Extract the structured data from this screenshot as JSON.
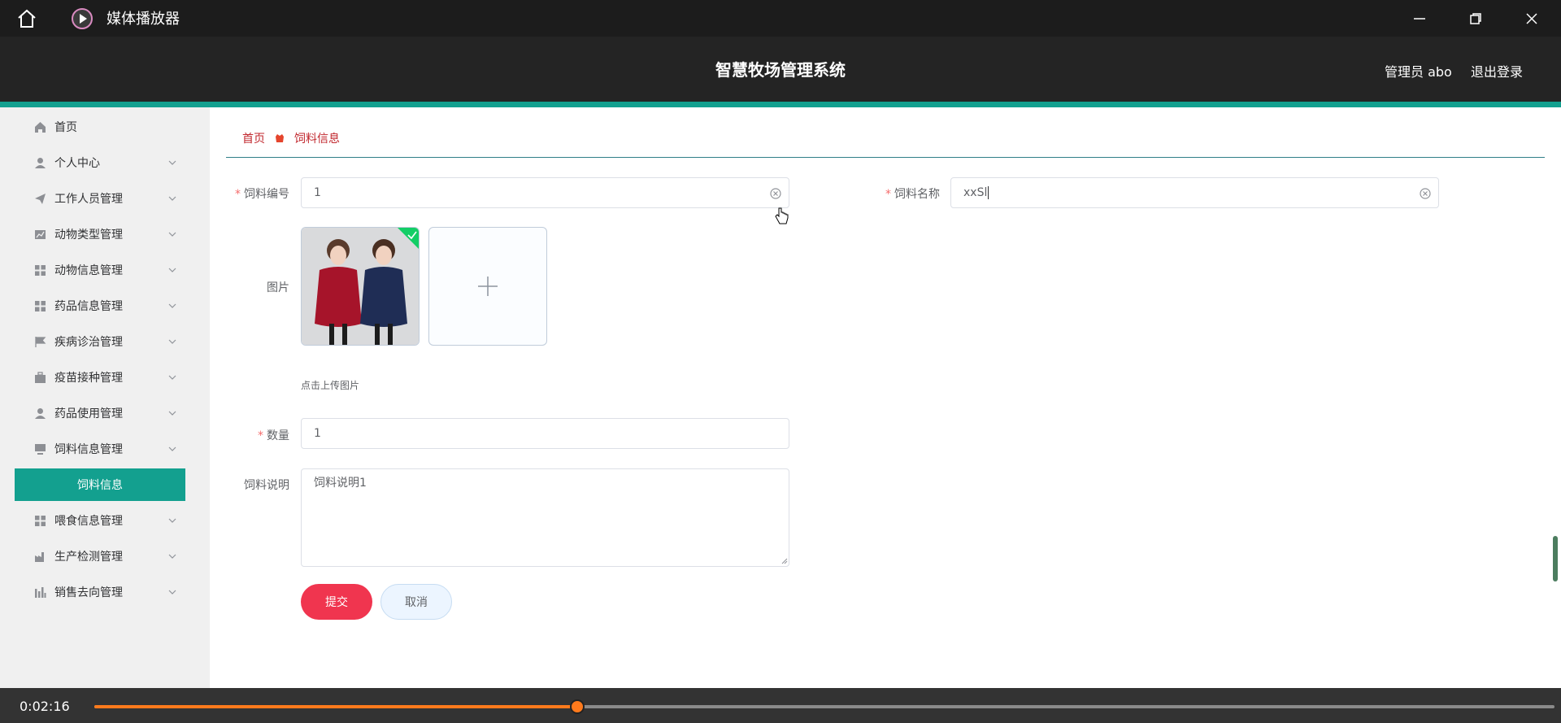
{
  "window": {
    "title": "媒体播放器"
  },
  "header": {
    "system_title": "智慧牧场管理系统",
    "admin_label": "管理员 abo",
    "logout_label": "退出登录"
  },
  "sidebar": {
    "items": [
      {
        "label": "首页",
        "icon": "home-icon"
      },
      {
        "label": "个人中心",
        "icon": "user-icon"
      },
      {
        "label": "工作人员管理",
        "icon": "send-icon"
      },
      {
        "label": "动物类型管理",
        "icon": "chart-icon"
      },
      {
        "label": "动物信息管理",
        "icon": "grid-icon"
      },
      {
        "label": "药品信息管理",
        "icon": "grid-icon"
      },
      {
        "label": "疾病诊治管理",
        "icon": "flag-icon"
      },
      {
        "label": "疫苗接种管理",
        "icon": "briefcase-icon"
      },
      {
        "label": "药品使用管理",
        "icon": "user-icon"
      },
      {
        "label": "饲料信息管理",
        "icon": "monitor-icon"
      },
      {
        "label": "饲料信息",
        "icon": ""
      },
      {
        "label": "喂食信息管理",
        "icon": "grid-icon"
      },
      {
        "label": "生产检测管理",
        "icon": "factory-icon"
      },
      {
        "label": "销售去向管理",
        "icon": "bar-chart-icon"
      }
    ],
    "active_index": 10
  },
  "breadcrumb": {
    "home": "首页",
    "current": "饲料信息"
  },
  "form": {
    "code_label": "饲料编号",
    "code_value": "1",
    "name_label": "饲料名称",
    "name_value": "xxSl",
    "image_label": "图片",
    "upload_tip": "点击上传图片",
    "qty_label": "数量",
    "qty_value": "1",
    "desc_label": "饲料说明",
    "desc_value": "饲料说明1",
    "submit_label": "提交",
    "cancel_label": "取消"
  },
  "player": {
    "time": "0:02:16",
    "progress": 0.331
  },
  "colors": {
    "accent": "#13a08f",
    "submit": "#f0354f",
    "progress": "#ff7a1c"
  }
}
